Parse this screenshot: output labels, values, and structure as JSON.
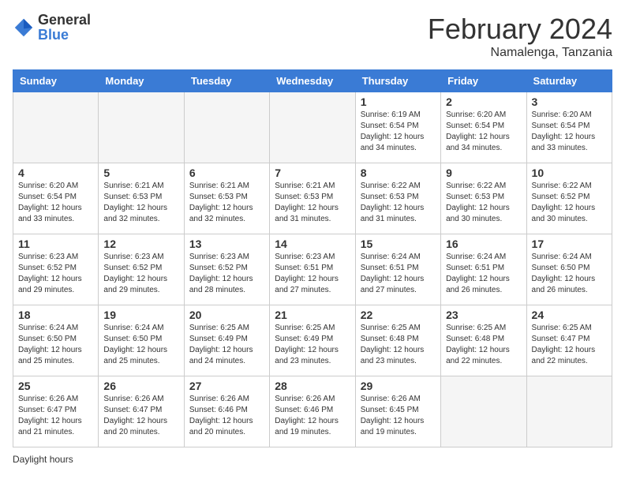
{
  "header": {
    "logo_general": "General",
    "logo_blue": "Blue",
    "month_title": "February 2024",
    "location": "Namalenga, Tanzania"
  },
  "calendar": {
    "days_of_week": [
      "Sunday",
      "Monday",
      "Tuesday",
      "Wednesday",
      "Thursday",
      "Friday",
      "Saturday"
    ],
    "weeks": [
      [
        {
          "day": "",
          "info": ""
        },
        {
          "day": "",
          "info": ""
        },
        {
          "day": "",
          "info": ""
        },
        {
          "day": "",
          "info": ""
        },
        {
          "day": "1",
          "info": "Sunrise: 6:19 AM\nSunset: 6:54 PM\nDaylight: 12 hours\nand 34 minutes."
        },
        {
          "day": "2",
          "info": "Sunrise: 6:20 AM\nSunset: 6:54 PM\nDaylight: 12 hours\nand 34 minutes."
        },
        {
          "day": "3",
          "info": "Sunrise: 6:20 AM\nSunset: 6:54 PM\nDaylight: 12 hours\nand 33 minutes."
        }
      ],
      [
        {
          "day": "4",
          "info": "Sunrise: 6:20 AM\nSunset: 6:54 PM\nDaylight: 12 hours\nand 33 minutes."
        },
        {
          "day": "5",
          "info": "Sunrise: 6:21 AM\nSunset: 6:53 PM\nDaylight: 12 hours\nand 32 minutes."
        },
        {
          "day": "6",
          "info": "Sunrise: 6:21 AM\nSunset: 6:53 PM\nDaylight: 12 hours\nand 32 minutes."
        },
        {
          "day": "7",
          "info": "Sunrise: 6:21 AM\nSunset: 6:53 PM\nDaylight: 12 hours\nand 31 minutes."
        },
        {
          "day": "8",
          "info": "Sunrise: 6:22 AM\nSunset: 6:53 PM\nDaylight: 12 hours\nand 31 minutes."
        },
        {
          "day": "9",
          "info": "Sunrise: 6:22 AM\nSunset: 6:53 PM\nDaylight: 12 hours\nand 30 minutes."
        },
        {
          "day": "10",
          "info": "Sunrise: 6:22 AM\nSunset: 6:52 PM\nDaylight: 12 hours\nand 30 minutes."
        }
      ],
      [
        {
          "day": "11",
          "info": "Sunrise: 6:23 AM\nSunset: 6:52 PM\nDaylight: 12 hours\nand 29 minutes."
        },
        {
          "day": "12",
          "info": "Sunrise: 6:23 AM\nSunset: 6:52 PM\nDaylight: 12 hours\nand 29 minutes."
        },
        {
          "day": "13",
          "info": "Sunrise: 6:23 AM\nSunset: 6:52 PM\nDaylight: 12 hours\nand 28 minutes."
        },
        {
          "day": "14",
          "info": "Sunrise: 6:23 AM\nSunset: 6:51 PM\nDaylight: 12 hours\nand 27 minutes."
        },
        {
          "day": "15",
          "info": "Sunrise: 6:24 AM\nSunset: 6:51 PM\nDaylight: 12 hours\nand 27 minutes."
        },
        {
          "day": "16",
          "info": "Sunrise: 6:24 AM\nSunset: 6:51 PM\nDaylight: 12 hours\nand 26 minutes."
        },
        {
          "day": "17",
          "info": "Sunrise: 6:24 AM\nSunset: 6:50 PM\nDaylight: 12 hours\nand 26 minutes."
        }
      ],
      [
        {
          "day": "18",
          "info": "Sunrise: 6:24 AM\nSunset: 6:50 PM\nDaylight: 12 hours\nand 25 minutes."
        },
        {
          "day": "19",
          "info": "Sunrise: 6:24 AM\nSunset: 6:50 PM\nDaylight: 12 hours\nand 25 minutes."
        },
        {
          "day": "20",
          "info": "Sunrise: 6:25 AM\nSunset: 6:49 PM\nDaylight: 12 hours\nand 24 minutes."
        },
        {
          "day": "21",
          "info": "Sunrise: 6:25 AM\nSunset: 6:49 PM\nDaylight: 12 hours\nand 23 minutes."
        },
        {
          "day": "22",
          "info": "Sunrise: 6:25 AM\nSunset: 6:48 PM\nDaylight: 12 hours\nand 23 minutes."
        },
        {
          "day": "23",
          "info": "Sunrise: 6:25 AM\nSunset: 6:48 PM\nDaylight: 12 hours\nand 22 minutes."
        },
        {
          "day": "24",
          "info": "Sunrise: 6:25 AM\nSunset: 6:47 PM\nDaylight: 12 hours\nand 22 minutes."
        }
      ],
      [
        {
          "day": "25",
          "info": "Sunrise: 6:26 AM\nSunset: 6:47 PM\nDaylight: 12 hours\nand 21 minutes."
        },
        {
          "day": "26",
          "info": "Sunrise: 6:26 AM\nSunset: 6:47 PM\nDaylight: 12 hours\nand 20 minutes."
        },
        {
          "day": "27",
          "info": "Sunrise: 6:26 AM\nSunset: 6:46 PM\nDaylight: 12 hours\nand 20 minutes."
        },
        {
          "day": "28",
          "info": "Sunrise: 6:26 AM\nSunset: 6:46 PM\nDaylight: 12 hours\nand 19 minutes."
        },
        {
          "day": "29",
          "info": "Sunrise: 6:26 AM\nSunset: 6:45 PM\nDaylight: 12 hours\nand 19 minutes."
        },
        {
          "day": "",
          "info": ""
        },
        {
          "day": "",
          "info": ""
        }
      ]
    ]
  },
  "footer": {
    "note": "Daylight hours"
  }
}
